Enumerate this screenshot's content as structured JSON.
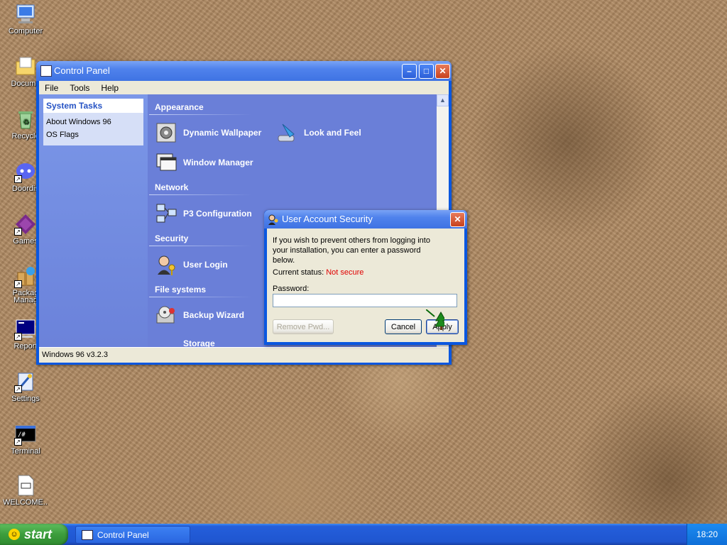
{
  "desktop": {
    "icons": [
      {
        "label": "Computer",
        "icon": "computer-icon"
      },
      {
        "label": "Docume",
        "icon": "documents-icon"
      },
      {
        "label": "Recycle",
        "icon": "recycle-bin-icon"
      },
      {
        "label": "Doordis",
        "icon": "chat-app-icon"
      },
      {
        "label": "Games",
        "icon": "games-icon"
      },
      {
        "label": "Packag Manag",
        "icon": "package-manager-icon"
      },
      {
        "label": "Report",
        "icon": "report-icon"
      },
      {
        "label": "Settings",
        "icon": "settings-icon"
      },
      {
        "label": "Terminal",
        "icon": "terminal-icon"
      },
      {
        "label": "WELCOME...",
        "icon": "text-file-icon"
      }
    ]
  },
  "control_panel": {
    "title": "Control Panel",
    "menu": [
      "File",
      "Tools",
      "Help"
    ],
    "system_tasks": {
      "heading": "System Tasks",
      "items": [
        "About Windows 96",
        "OS Flags"
      ]
    },
    "sections": {
      "appearance": "Appearance",
      "network": "Network",
      "security": "Security",
      "file_systems": "File systems"
    },
    "items": {
      "dynamic_wallpaper": "Dynamic Wallpaper",
      "look_and_feel": "Look and Feel",
      "window_manager": "Window Manager",
      "p3_configuration": "P3 Configuration",
      "user_login": "User Login",
      "backup_wizard": "Backup Wizard",
      "storage": "Storage"
    },
    "status": "Windows 96 v3.2.3"
  },
  "dialog": {
    "title": "User Account Security",
    "description": "If you wish to prevent others from logging into your installation, you can enter a password below.",
    "status_label": "Current status:",
    "status_value": "Not secure",
    "password_label": "Password:",
    "password_value": "",
    "remove_label": "Remove Pwd...",
    "cancel_label": "Cancel",
    "apply_label": "Apply"
  },
  "taskbar": {
    "start_label": "start",
    "task_label": "Control Panel",
    "clock": "18:20"
  }
}
